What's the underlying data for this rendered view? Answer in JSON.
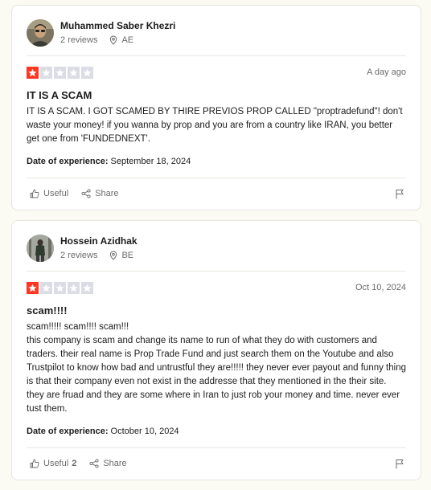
{
  "reviews": [
    {
      "reviewer_name": "Muhammed Saber Khezri",
      "reviews_count": "2 reviews",
      "country": "AE",
      "rating": 1,
      "date": "A day ago",
      "title": "IT IS A SCAM",
      "body": [
        "IT IS A SCAM. I GOT SCAMED BY THIRE PREVIOS PROP CALLED \"proptradefund\"! don't waste your money! if you wanna by prop and you are from a country like IRAN, you better get one from 'FUNDEDNEXT'."
      ],
      "experience_label": "Date of experience:",
      "experience_date": "September 18, 2024",
      "useful_label": "Useful",
      "useful_count": "",
      "share_label": "Share"
    },
    {
      "reviewer_name": "Hossein Azidhak",
      "reviews_count": "2 reviews",
      "country": "BE",
      "rating": 1,
      "date": "Oct 10, 2024",
      "title": "scam!!!!",
      "body": [
        "scam!!!!! scam!!!! scam!!!",
        "this company is scam and change its name to run of what they do with customers and traders. their real name is Prop Trade Fund and just search them on the Youtube and also Trustpilot to know how bad and untrustful they are!!!!! they never ever payout and funny thing is that their company even not exist in the addresse that they mentioned in the their site. they are fruad and they are some where in Iran to just rob your money and time. never ever tust them."
      ],
      "experience_label": "Date of experience:",
      "experience_date": "October 10, 2024",
      "useful_label": "Useful",
      "useful_count": "2",
      "share_label": "Share"
    }
  ],
  "colors": {
    "star_on": "#ff3722",
    "star_off": "#dcdce6",
    "page_bg": "#fcfbf3"
  }
}
